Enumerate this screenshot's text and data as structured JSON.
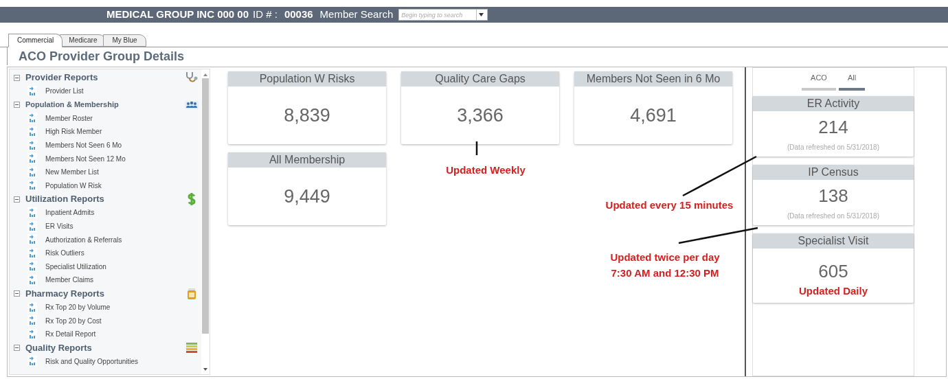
{
  "header": {
    "company": "MEDICAL GROUP INC 000 00",
    "id_label": "ID # :",
    "id_value": "00036",
    "search_label": "Member Search",
    "search_placeholder": "Begin typing to search"
  },
  "tabs": [
    {
      "label": "Commercial",
      "selected": true
    },
    {
      "label": "Medicare",
      "selected": false
    },
    {
      "label": "My Blue",
      "selected": false
    }
  ],
  "page_title": "ACO Provider Group Details",
  "sidebar": {
    "sections": [
      {
        "title": "Provider Reports",
        "kind": "stethoscope",
        "expanded": true,
        "items": [
          "Provider List"
        ]
      },
      {
        "title": "Population & Membership",
        "kind": "people",
        "expanded": true,
        "items": [
          "Member Roster",
          "High Risk Member",
          "Members Not Seen 6 Mo",
          "Members Not Seen 12 Mo",
          "New Member List",
          "Population W Risk"
        ]
      },
      {
        "title": "Utilization Reports",
        "kind": "dollar",
        "expanded": true,
        "items": [
          "Inpatient Admits",
          "ER Visits",
          "Authorization & Referrals",
          "Risk Outliers",
          "Specialist Utilization",
          "Member Claims"
        ]
      },
      {
        "title": "Pharmacy Reports",
        "kind": "pill-bottle",
        "expanded": true,
        "items": [
          "Rx Top 20 by Volume",
          "Rx Top 20 by Cost",
          "Rx Detail Report"
        ]
      },
      {
        "title": "Quality Reports",
        "kind": "bars",
        "expanded": true,
        "items": [
          "Risk and Quality Opportunities"
        ]
      }
    ]
  },
  "tiles": [
    {
      "title": "Population W Risks",
      "value": "8,839"
    },
    {
      "title": "Quality Care Gaps",
      "value": "3,366"
    },
    {
      "title": "Members Not Seen in 6 Mo",
      "value": "4,691"
    },
    {
      "title": "All Membership",
      "value": "9,449"
    }
  ],
  "scope_toggle": [
    {
      "label": "ACO",
      "selected": false
    },
    {
      "label": "All",
      "selected": true
    }
  ],
  "activity_tiles": [
    {
      "title": "ER Activity",
      "value": "214",
      "note": "(Data refreshed on 5/31/2018)"
    },
    {
      "title": "IP Census",
      "value": "138",
      "note": "(Data refreshed on 5/31/2018)"
    },
    {
      "title": "Specialist Visit",
      "value": "605",
      "annotation": "Updated Daily"
    }
  ],
  "annotations": [
    {
      "lines": [
        "Updated Weekly"
      ]
    },
    {
      "lines": [
        "Updated every 15 minutes"
      ]
    },
    {
      "lines": [
        "Updated twice per day",
        "7:30 AM and 12:30 PM"
      ]
    }
  ]
}
